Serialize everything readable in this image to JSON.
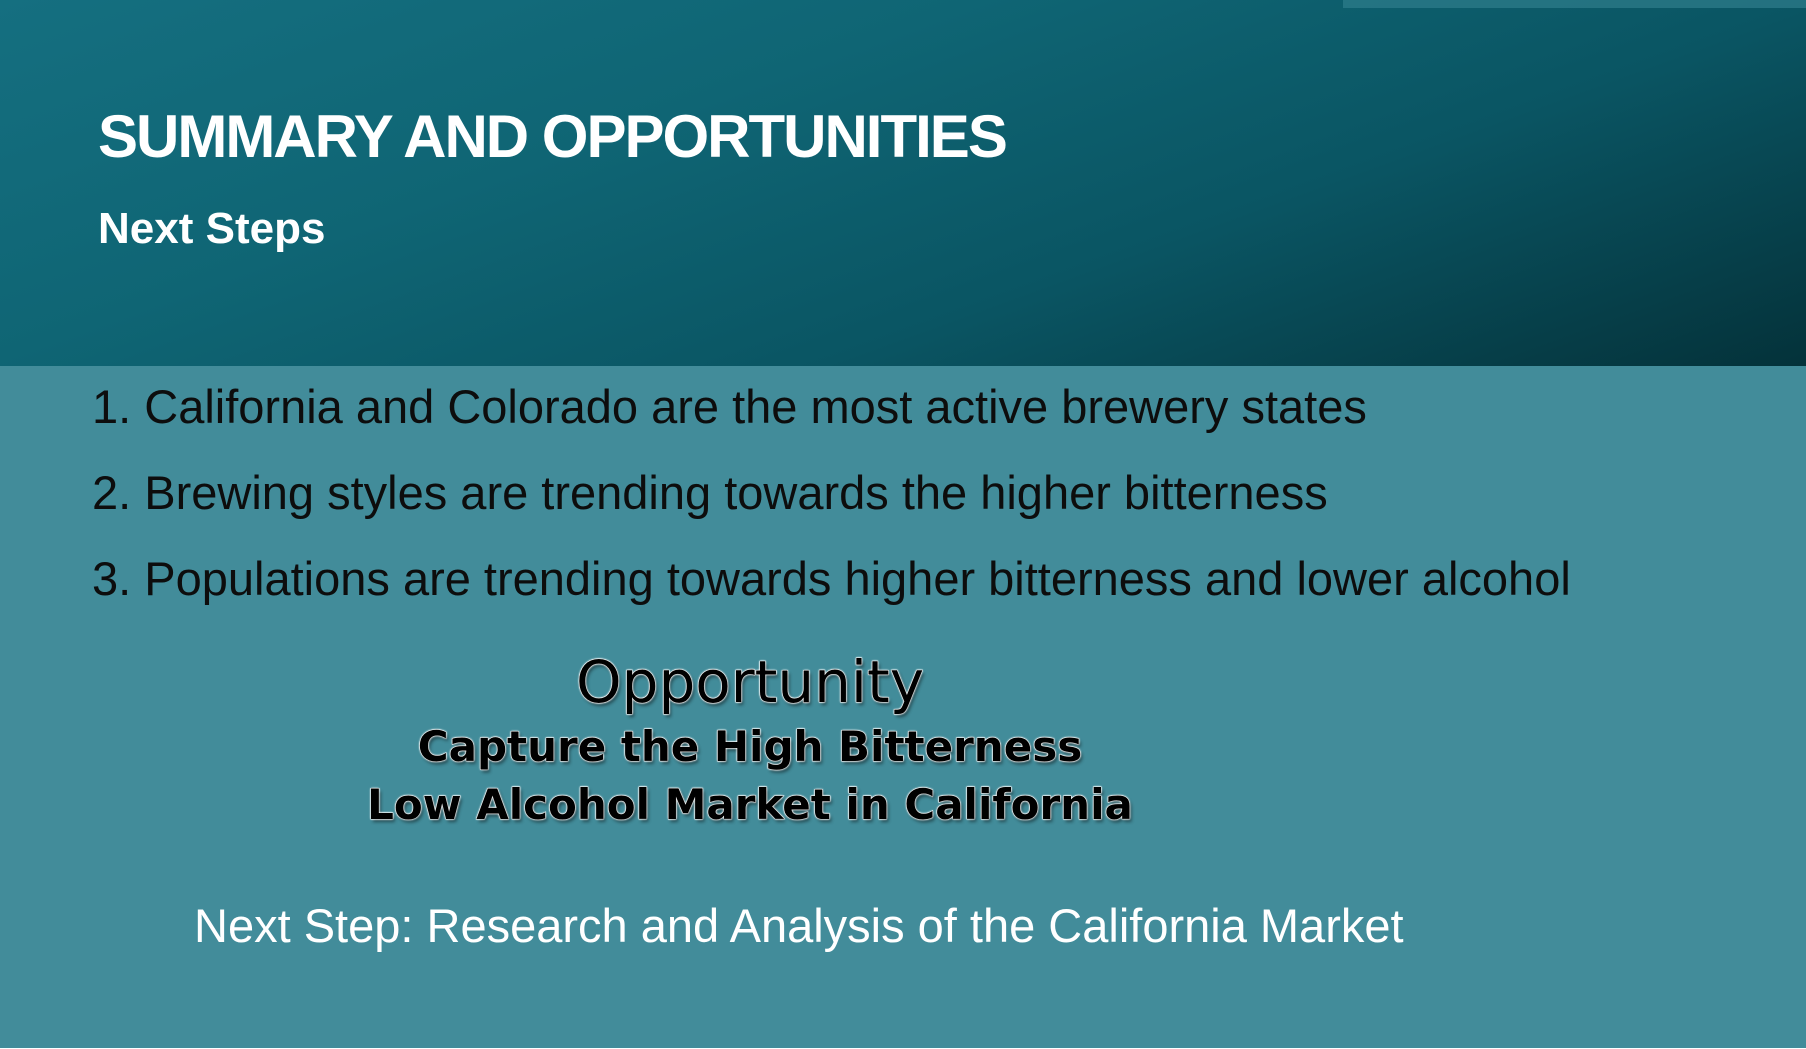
{
  "header": {
    "title": "SUMMARY AND OPPORTUNITIES",
    "subtitle": "Next Steps"
  },
  "points": [
    "1. California and Colorado are the most active brewery states",
    "2. Brewing styles are trending towards the higher bitterness",
    "3. Populations are trending towards higher bitterness and lower alcohol"
  ],
  "opportunity": {
    "heading": "Opportunity",
    "line1": "Capture the High Bitterness",
    "line2": "Low Alcohol Market in California"
  },
  "next_step": "Next Step: Research and Analysis of the California Market",
  "colors": {
    "header_bg": "#0f6574",
    "body_bg": "#428c9a",
    "title_text": "#ffffff",
    "body_text": "#0d0d0d"
  }
}
